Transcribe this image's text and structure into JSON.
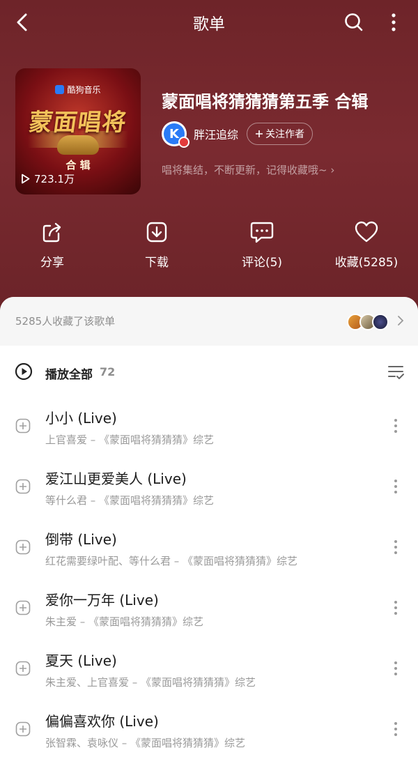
{
  "header": {
    "title": "歌单"
  },
  "cover": {
    "brand": "酷狗音乐",
    "art_title": "蒙面唱将",
    "art_subtitle": "合 辑",
    "play_count": "723.1万"
  },
  "album": {
    "title": "蒙面唱将猜猜猜第五季 合辑",
    "author_name": "胖汪追综",
    "author_avatar_letter": "K",
    "follow_label": "关注作者",
    "description": "唱将集结，不断更新，记得收藏哦~ ›"
  },
  "actions": [
    {
      "label": "分享",
      "icon": "share-icon"
    },
    {
      "label": "下载",
      "icon": "download-icon"
    },
    {
      "label": "评论(5)",
      "icon": "comment-icon"
    },
    {
      "label": "收藏(5285)",
      "icon": "heart-icon"
    }
  ],
  "collectors": {
    "text": "5285人收藏了该歌单"
  },
  "playall": {
    "label": "播放全部",
    "count": "72"
  },
  "songs": [
    {
      "title": "小小 (Live)",
      "meta": "上官喜爱 – 《蒙面唱将猜猜猜》综艺"
    },
    {
      "title": "爱江山更爱美人 (Live)",
      "meta": "等什么君 – 《蒙面唱将猜猜猜》综艺"
    },
    {
      "title": "倒带 (Live)",
      "meta": "红花需要绿叶配、等什么君 – 《蒙面唱将猜猜猜》综艺"
    },
    {
      "title": "爱你一万年 (Live)",
      "meta": "朱主爱 – 《蒙面唱将猜猜猜》综艺"
    },
    {
      "title": "夏天 (Live)",
      "meta": "朱主爱、上官喜爱 – 《蒙面唱将猜猜猜》综艺"
    },
    {
      "title": "偏偏喜欢你 (Live)",
      "meta": "张智霖、袁咏仪 – 《蒙面唱将猜猜猜》综艺"
    }
  ],
  "colors": {
    "hero_bg": "#7a2a30",
    "accent_blue": "#2a7bf6",
    "badge_red": "#e23b3b"
  }
}
